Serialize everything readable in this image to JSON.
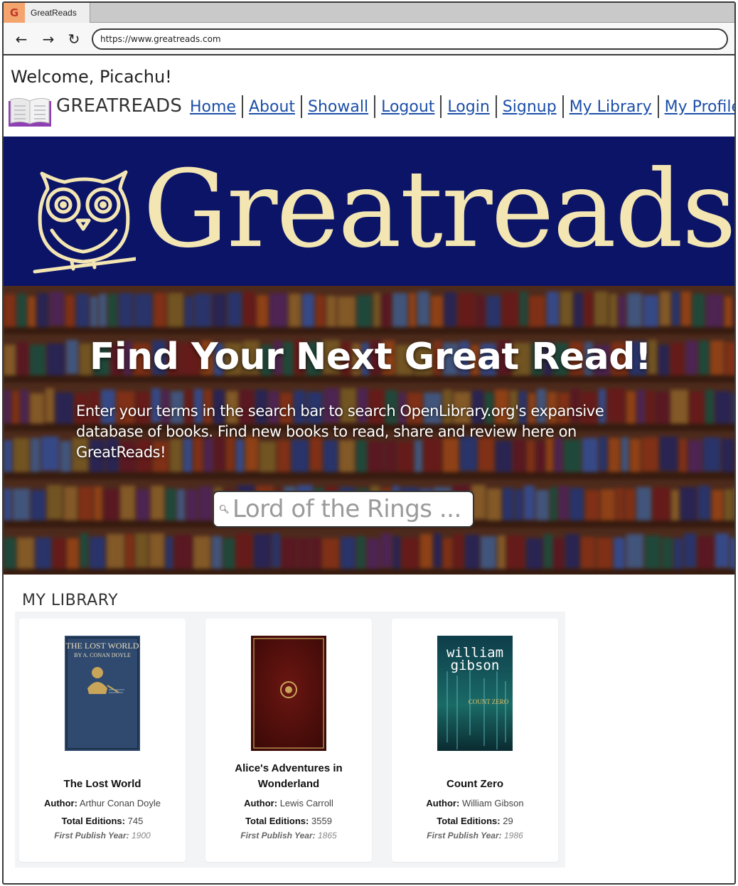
{
  "browser": {
    "tab_title": "GreatReads",
    "favicon_letter": "G",
    "back_icon": "←",
    "forward_icon": "→",
    "reload_icon": "↻",
    "url": "https://www.greatreads.com"
  },
  "header": {
    "welcome": "Welcome, Picachu!",
    "brand": "GREATREADS",
    "nav": [
      "Home",
      "About",
      "Showall",
      "Logout",
      "Login",
      "Signup",
      "My Library",
      "My Profile"
    ]
  },
  "banner": {
    "title": "Greatreads",
    "bg_color": "#0b1467",
    "text_color": "#f4e6b3"
  },
  "hero": {
    "title": "Find Your Next Great Read!",
    "description": "Enter your terms in the search bar to search OpenLibrary.org's expansive database of books.  Find new books to read, share and review here on GreatReads!",
    "search_placeholder": "Lord of the Rings ..."
  },
  "library": {
    "heading": "MY LIBRARY",
    "author_label": "Author:",
    "editions_label": "Total Editions:",
    "year_label": "First Publish Year:",
    "books": [
      {
        "title": "The Lost World",
        "author": "Arthur Conan Doyle",
        "editions": "745",
        "year": "1900",
        "cover_text_1": "THE LOST WORLD",
        "cover_text_2": "BY A. CONAN DOYLE"
      },
      {
        "title": "Alice's Adventures in Wonderland",
        "author": "Lewis Carroll",
        "editions": "3559",
        "year": "1865"
      },
      {
        "title": "Count Zero",
        "author": "William Gibson",
        "editions": "29",
        "year": "1986",
        "cover_text_1": "william",
        "cover_text_2": "gibson",
        "cover_text_3": "COUNT ZERO"
      }
    ]
  }
}
